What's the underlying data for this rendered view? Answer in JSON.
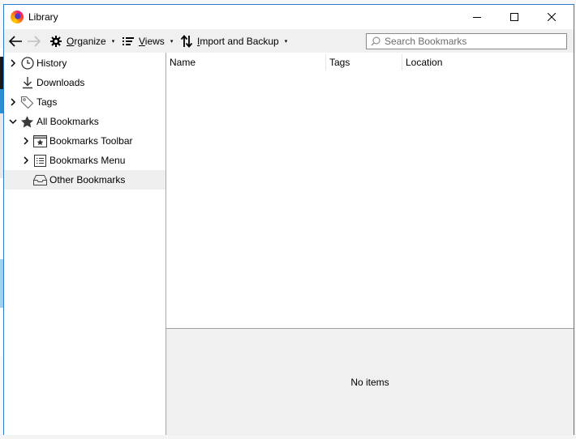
{
  "window": {
    "title": "Library",
    "app_icon": "firefox-icon",
    "controls": {
      "minimize": "minimize-icon",
      "maximize": "maximize-icon",
      "close": "close-icon"
    },
    "accent_color": "#2b7bd0"
  },
  "toolbar": {
    "back_icon": "arrow-left-icon",
    "forward_icon": "arrow-right-icon",
    "organize": {
      "label": "Organize",
      "mnemonic": "O",
      "rest": "rganize",
      "icon": "gear-icon"
    },
    "views": {
      "label": "Views",
      "mnemonic": "V",
      "rest": "iews",
      "icon": "list-icon"
    },
    "import_backup": {
      "label": "Import and Backup",
      "mnemonic": "I",
      "rest": "mport and Backup",
      "icon": "import-export-icon"
    },
    "dropdown_glyph": "▾",
    "search": {
      "placeholder": "Search Bookmarks",
      "value": "",
      "icon": "search-icon"
    }
  },
  "sidebar": {
    "items": [
      {
        "label": "History",
        "icon": "clock-icon",
        "twisty": "collapsed",
        "level": 0
      },
      {
        "label": "Downloads",
        "icon": "download-icon",
        "twisty": "none",
        "level": 0
      },
      {
        "label": "Tags",
        "icon": "tag-icon",
        "twisty": "collapsed",
        "level": 0
      },
      {
        "label": "All Bookmarks",
        "icon": "star-icon",
        "twisty": "expanded",
        "level": 0
      },
      {
        "label": "Bookmarks Toolbar",
        "icon": "bookmarks-toolbar-icon",
        "twisty": "collapsed",
        "level": 1
      },
      {
        "label": "Bookmarks Menu",
        "icon": "bookmarks-menu-icon",
        "twisty": "collapsed",
        "level": 1
      },
      {
        "label": "Other Bookmarks",
        "icon": "inbox-icon",
        "twisty": "none",
        "level": 1,
        "selected": true
      }
    ]
  },
  "main": {
    "columns": [
      "Name",
      "Tags",
      "Location"
    ],
    "rows": [],
    "details": {
      "empty_text": "No items"
    }
  }
}
